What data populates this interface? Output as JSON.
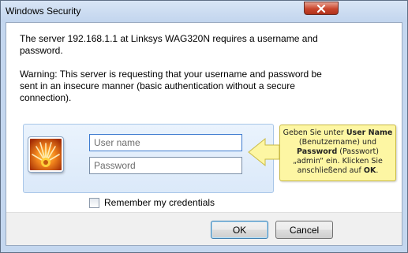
{
  "window": {
    "title": "Windows Security"
  },
  "message": {
    "line1": "The server 192.168.1.1 at Linksys WAG320N  requires a username and",
    "line2": "password.",
    "warning_line1": "Warning: This server is requesting that your username and password be",
    "warning_line2": "sent in an insecure manner (basic authentication without a secure",
    "warning_line3": "connection)."
  },
  "credentials": {
    "username_placeholder": "User name",
    "username_value": "",
    "password_placeholder": "Password",
    "password_value": "",
    "remember_label": "Remember my credentials",
    "remember_checked": false
  },
  "buttons": {
    "ok_label": "OK",
    "cancel_label": "Cancel"
  },
  "callout": {
    "part1": "Geben Sie unter ",
    "user_name_bold": "User Name",
    "part2": " (Benutzername) und ",
    "password_bold": "Password",
    "part3": " (Passwort) „admin“ ein. Klicken Sie anschließend auf ",
    "ok_bold": "OK",
    "part4": "."
  },
  "icons": {
    "close": "close-icon",
    "avatar": "user-avatar-icon",
    "arrow": "callout-arrow-icon"
  },
  "colors": {
    "close_button": "#c9462d",
    "callout_background": "#fdf6a3",
    "panel_border": "#a8c6e8"
  }
}
